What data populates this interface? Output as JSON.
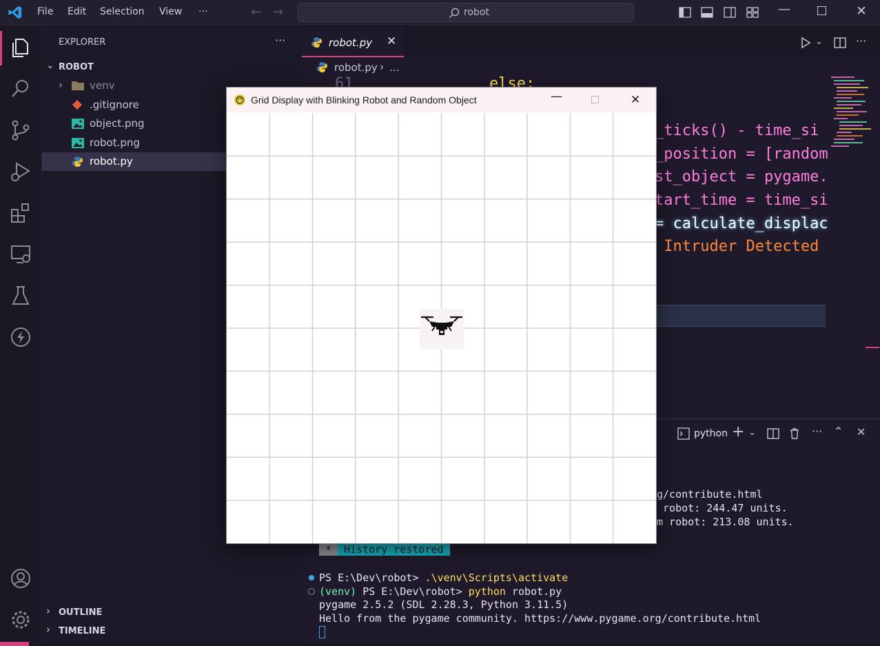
{
  "menu": [
    "File",
    "Edit",
    "Selection",
    "View",
    "···"
  ],
  "search_text": "robot",
  "sidebar": {
    "title": "EXPLORER",
    "more": "···",
    "root": "ROBOT",
    "items": [
      {
        "label": "venv",
        "icon": "folder-icon"
      },
      {
        "label": ".gitignore",
        "icon": "git-icon"
      },
      {
        "label": "object.png",
        "icon": "image-icon"
      },
      {
        "label": "robot.png",
        "icon": "image-icon"
      },
      {
        "label": "robot.py",
        "icon": "python-icon"
      }
    ],
    "outline": "OUTLINE",
    "timeline": "TIMELINE"
  },
  "editor": {
    "tab_label": "robot.py",
    "breadcrumb_file": "robot.py",
    "breadcrumb_more": "…",
    "line_number": "61",
    "code_lines": [
      {
        "text": "else:"
      },
      {
        "text": "_ticks() - time_si"
      },
      {
        "text": "_position = [random"
      },
      {
        "text": "st_object = pygame."
      },
      {
        "text": "tart_time = time_si"
      },
      {
        "text": "= calculate_displac"
      },
      {
        "text": " Intruder Detected "
      }
    ]
  },
  "panel": {
    "terminal_name": "python",
    "lines_top": [
      "g/contribute.html",
      " robot: 244.47 units.",
      "m robot: 213.08 units."
    ],
    "history_star": " * ",
    "history_text": " History restored ",
    "prompt1_ps": "PS E:\\Dev\\robot> ",
    "prompt1_cmd": ".\\venv\\Scripts\\activate",
    "prompt2_venv": "(venv) ",
    "prompt2_ps": "PS E:\\Dev\\robot> ",
    "prompt2_cmd": "python",
    "prompt2_arg": " robot.py",
    "out1": "pygame 2.5.2 (SDL 2.28.3, Python 3.11.5)",
    "out2": "Hello from the pygame community. https://www.pygame.org/contribute.html"
  },
  "pygame_window": {
    "title": "Grid Display with Blinking Robot and Random Object",
    "grid_cols": 10,
    "grid_rows": 10,
    "robot_cell": [
      4,
      4
    ]
  },
  "colors": {
    "accent": "#d6437c",
    "keyword": "#f7a833",
    "string": "#ff8b39",
    "identifier": "#ff7edb",
    "plain": "#ffffff"
  }
}
